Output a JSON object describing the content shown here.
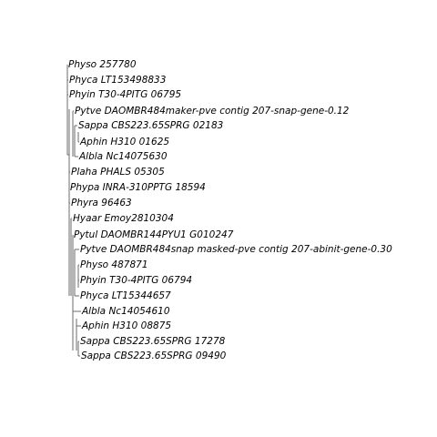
{
  "tree": {
    "leaves": [
      "Physo 257780",
      "Phyca LT153498833",
      "Phyin T30-4PITG 06795",
      "Pytve DAOMBR484maker-pve contig 207-snap-gene-0.12",
      "Sappa CBS223.65SPRG 02183",
      "Aphin H310 01625",
      "Albla Nc14075630",
      "Plaha PHALS 05305",
      "Phypa INRA-310PPTG 18594",
      "Phyra 96463",
      "Hyaar Emoy2810304",
      "Pytul DAOMBR144PYU1 G010247",
      "Pytve DAOMBR484snap masked-pve contig 207-abinit-gene-0.30",
      "Physo 487871",
      "Phyin T30-4PITG 06794",
      "Phyca LT15344657",
      "Albla Nc14054610",
      "Aphin H310 08875",
      "Sappa CBS223.65SPRG 17278",
      "Sappa CBS223.65SPRG 09490"
    ]
  }
}
